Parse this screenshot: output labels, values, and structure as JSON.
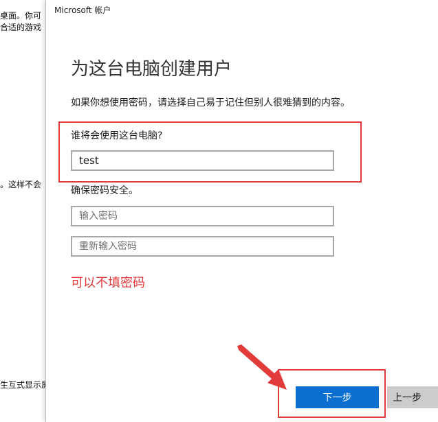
{
  "background_window": {
    "lines": [
      "桌面。你可",
      "合适的游戏",
      "。这样不会",
      "生互式显示屏"
    ]
  },
  "dialog": {
    "title": "Microsoft 帐户",
    "heading": "为这台电脑创建用户",
    "description": "如果你想使用密码，请选择自己易于记住但别人很难猜到的内容。",
    "user_label": "谁将会使用这台电脑?",
    "username_value": "test",
    "password_label": "确保密码安全。",
    "password_placeholder": "输入密码",
    "confirm_password_placeholder": "重新输入密码",
    "note": "可以不填密码",
    "next_button": "下一步",
    "back_button": "上一步"
  },
  "colors": {
    "accent": "#0a6fd1",
    "annotation_red": "#e23b3b",
    "secondary_button": "#cccccc"
  }
}
